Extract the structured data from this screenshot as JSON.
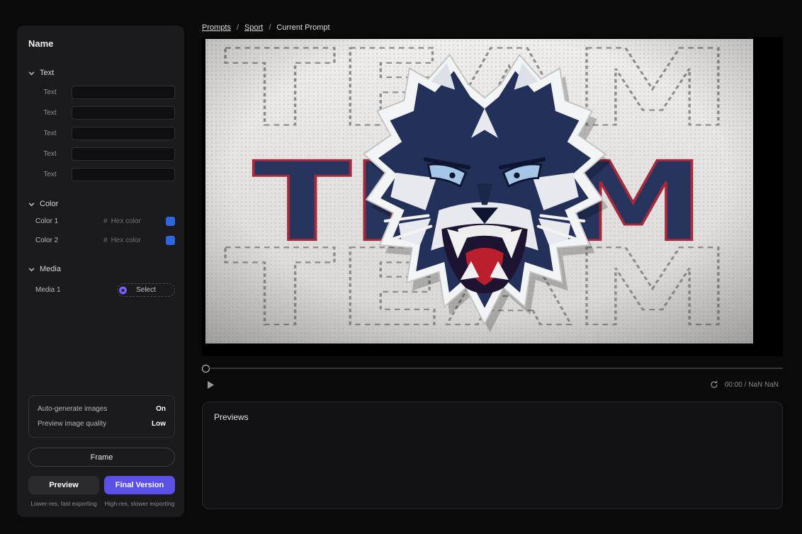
{
  "breadcrumb": {
    "prompts": "Prompts",
    "sport": "Sport",
    "current": "Current Prompt",
    "sep": "/"
  },
  "sidebar": {
    "title": "Name",
    "text_section": {
      "label": "Text",
      "rows": [
        {
          "label": "Text",
          "value": ""
        },
        {
          "label": "Text",
          "value": ""
        },
        {
          "label": "Text",
          "value": ""
        },
        {
          "label": "Text",
          "value": ""
        },
        {
          "label": "Text",
          "value": ""
        }
      ]
    },
    "color_section": {
      "label": "Color",
      "rows": [
        {
          "label": "Color 1",
          "hash": "#",
          "placeholder": "Hex color",
          "swatch": "#2f66e0"
        },
        {
          "label": "Color 2",
          "hash": "#",
          "placeholder": "Hex color",
          "swatch": "#2f66e0"
        }
      ]
    },
    "media_section": {
      "label": "Media",
      "rows": [
        {
          "label": "Media 1",
          "button": "Select"
        }
      ]
    },
    "settings": {
      "rows": [
        {
          "label": "Auto-generate images",
          "value": "On"
        },
        {
          "label": "Preview image quality",
          "value": "Low"
        }
      ]
    },
    "frame_button": "Frame",
    "actions": {
      "preview": {
        "label": "Preview",
        "caption": "Lower-res, fast exporting"
      },
      "final": {
        "label": "Final Version",
        "caption": "High-res, slower exporting"
      }
    }
  },
  "player": {
    "time": "00:00 / NaN NaN"
  },
  "video": {
    "word": "TEAM"
  },
  "previews": {
    "title": "Previews"
  },
  "colors": {
    "accent": "#5b50e6",
    "swatch_blue": "#2f66e0",
    "navy": "#26345e",
    "red": "#a3293c"
  }
}
